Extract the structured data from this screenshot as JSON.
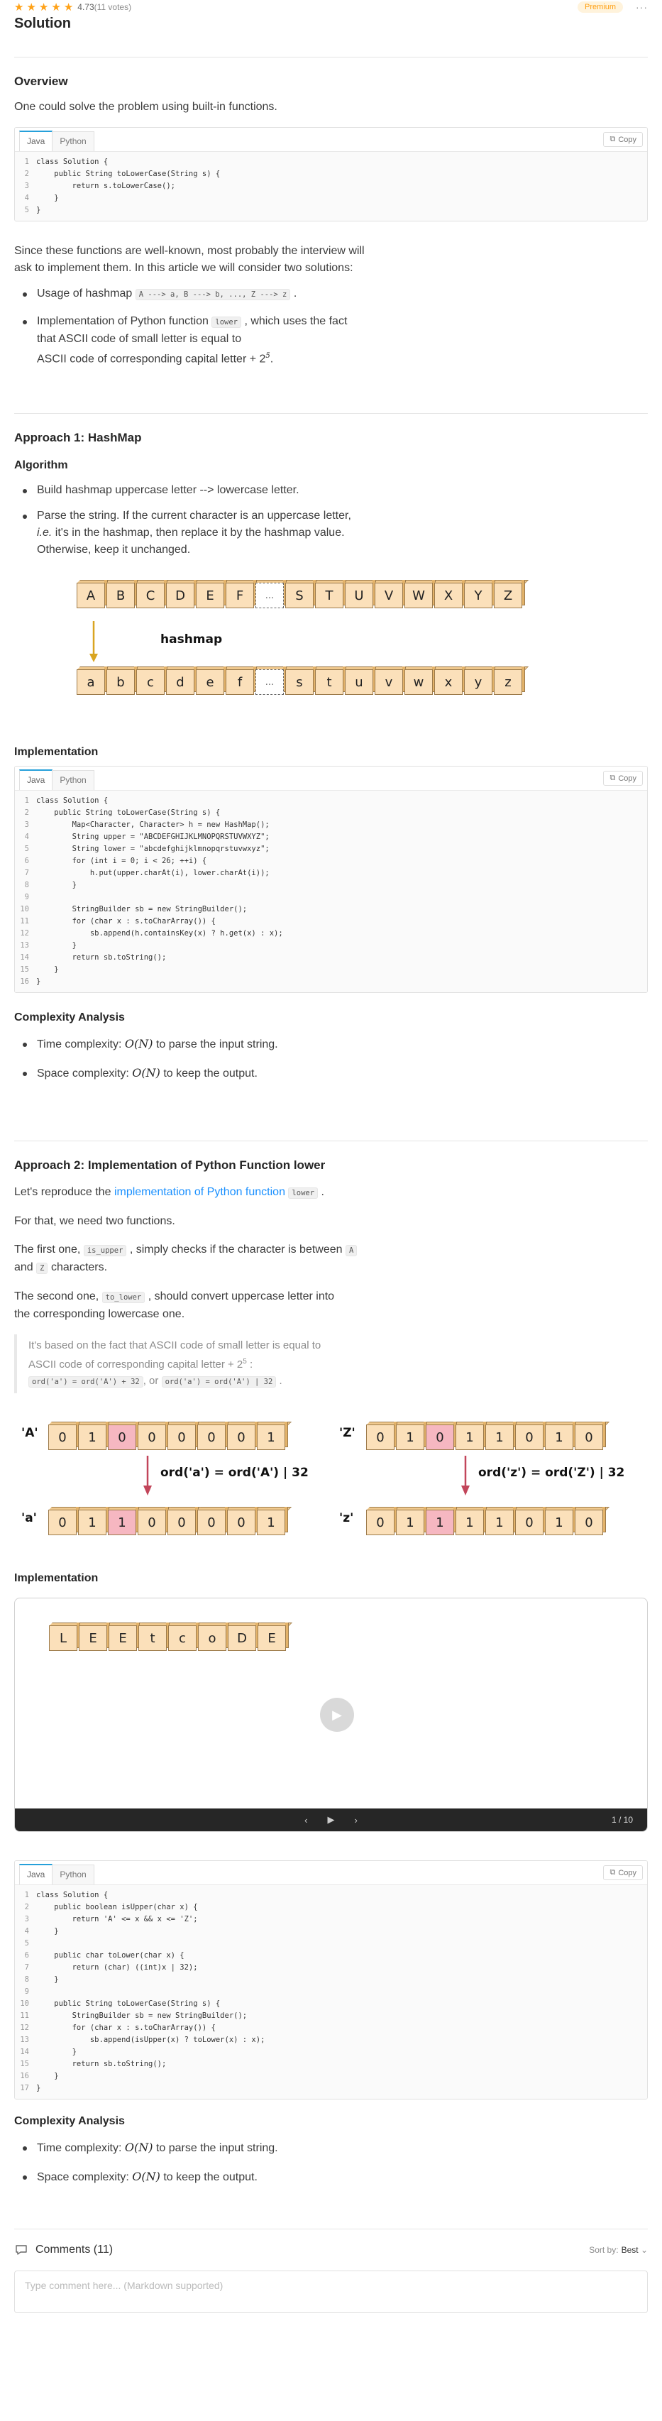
{
  "header": {
    "rating": "4.73",
    "votes": "(11 votes)",
    "premium": "Premium",
    "more": "···"
  },
  "title": "Solution",
  "overview": {
    "heading": "Overview",
    "intro": "One could solve the problem using built-in functions.",
    "p2a": "Since these functions are well-known, most probably the interview will",
    "p2b": "ask to implement them. In this article we will consider two solutions:",
    "bullet1_text": "Usage of hashmap",
    "bullet1_code": "A ---> a, B ---> b, ..., Z ---> z",
    "bullet2_a": "Implementation of Python function",
    "bullet2_code": "lower",
    "bullet2_b": ", which uses the fact",
    "bullet2_c": "that ASCII code of small letter is equal to",
    "bullet2_d": "ASCII code of corresponding capital letter + 2",
    "bullet2_sup": "5",
    "bullet2_end": "."
  },
  "tabs": {
    "java": "Java",
    "python": "Python",
    "copy": "Copy"
  },
  "code1": [
    "class Solution {",
    "    public String toLowerCase(String s) {",
    "        return s.toLowerCase();",
    "    }",
    "}"
  ],
  "approach1": {
    "heading": "Approach 1: HashMap",
    "algorithm": "Algorithm",
    "b1": "Build hashmap uppercase letter --> lowercase letter.",
    "b2a": "Parse the string. If the current character is an uppercase letter,",
    "b2b_i": "i.e.",
    "b2b": " it's in the hashmap, then replace it by the hashmap value.",
    "b2c": "Otherwise, keep it unchanged.",
    "upper": [
      "A",
      "B",
      "C",
      "D",
      "E",
      "F",
      "...",
      "S",
      "T",
      "U",
      "V",
      "W",
      "X",
      "Y",
      "Z"
    ],
    "lower": [
      "a",
      "b",
      "c",
      "d",
      "e",
      "f",
      "...",
      "s",
      "t",
      "u",
      "v",
      "w",
      "x",
      "y",
      "z"
    ],
    "hashmap_label": "hashmap",
    "implementation": "Implementation",
    "complexity": "Complexity Analysis",
    "time_a": "Time complexity:",
    "time_math": "O(N)",
    "time_b": "to parse the input string.",
    "space_a": "Space complexity:",
    "space_math": "O(N)",
    "space_b": "to keep the output."
  },
  "code2": [
    "class Solution {",
    "    public String toLowerCase(String s) {",
    "        Map<Character, Character> h = new HashMap();",
    "        String upper = \"ABCDEFGHIJKLMNOPQRSTUVWXYZ\";",
    "        String lower = \"abcdefghijklmnopqrstuvwxyz\";",
    "        for (int i = 0; i < 26; ++i) {",
    "            h.put(upper.charAt(i), lower.charAt(i));",
    "        }",
    "",
    "        StringBuilder sb = new StringBuilder();",
    "        for (char x : s.toCharArray()) {",
    "            sb.append(h.containsKey(x) ? h.get(x) : x);",
    "        }",
    "        return sb.toString();",
    "    }",
    "}"
  ],
  "approach2": {
    "heading": "Approach 2: Implementation of Python Function lower",
    "p1a": "Let's reproduce the",
    "p1_link": "implementation of Python function",
    "p1_code": "lower",
    "p1_end": ".",
    "p2": "For that, we need two functions.",
    "p3a": "The first one,",
    "p3_code": "is_upper",
    "p3b": ", simply checks if the character is between",
    "p3_codeA": "A",
    "p3c": "and",
    "p3_codeZ": "Z",
    "p3d": "characters.",
    "p4a": "The second one,",
    "p4_code": "to_lower",
    "p4b": ", should convert uppercase letter into",
    "p4c": "the corresponding lowercase one.",
    "note_a": "It's based on the fact that ASCII code of small letter is equal to",
    "note_b": "ASCII code of corresponding capital letter + 2",
    "note_sup": "5",
    "note_colon": ":",
    "note_code1": "ord('a') = ord('A') + 32",
    "note_or": ", or",
    "note_code2": "ord('a') = ord('A') | 32",
    "note_end": ".",
    "bits_A": [
      "0",
      "1",
      "0",
      "0",
      "0",
      "0",
      "0",
      "1"
    ],
    "bits_a": [
      "0",
      "1",
      "1",
      "0",
      "0",
      "0",
      "0",
      "1"
    ],
    "bits_Z": [
      "0",
      "1",
      "0",
      "1",
      "1",
      "0",
      "1",
      "0"
    ],
    "bits_z": [
      "0",
      "1",
      "1",
      "1",
      "1",
      "0",
      "1",
      "0"
    ],
    "lab_A": "'A'",
    "lab_a": "'a'",
    "lab_Z": "'Z'",
    "lab_z": "'z'",
    "eq_a": "ord('a') = ord('A') | 32",
    "eq_z": "ord('z') = ord('Z') | 32",
    "implementation": "Implementation",
    "anim_letters": [
      "L",
      "E",
      "E",
      "t",
      "c",
      "o",
      "D",
      "E"
    ],
    "anim_counter": "1 / 10",
    "complexity": "Complexity Analysis",
    "time_a": "Time complexity:",
    "time_math": "O(N)",
    "time_b": "to parse the input string.",
    "space_a": "Space complexity:",
    "space_math": "O(N)",
    "space_b": "to keep the output."
  },
  "code3": [
    "class Solution {",
    "    public boolean isUpper(char x) {",
    "        return 'A' <= x && x <= 'Z';",
    "    }",
    "",
    "    public char toLower(char x) {",
    "        return (char) ((int)x | 32);",
    "    }",
    "",
    "    public String toLowerCase(String s) {",
    "        StringBuilder sb = new StringBuilder();",
    "        for (char x : s.toCharArray()) {",
    "            sb.append(isUpper(x) ? toLower(x) : x);",
    "        }",
    "        return sb.toString();",
    "    }",
    "}"
  ],
  "comments": {
    "label": "Comments (11)",
    "sort_label": "Sort by:",
    "sort_value": "Best",
    "placeholder": "Type comment here... (Markdown supported)"
  }
}
